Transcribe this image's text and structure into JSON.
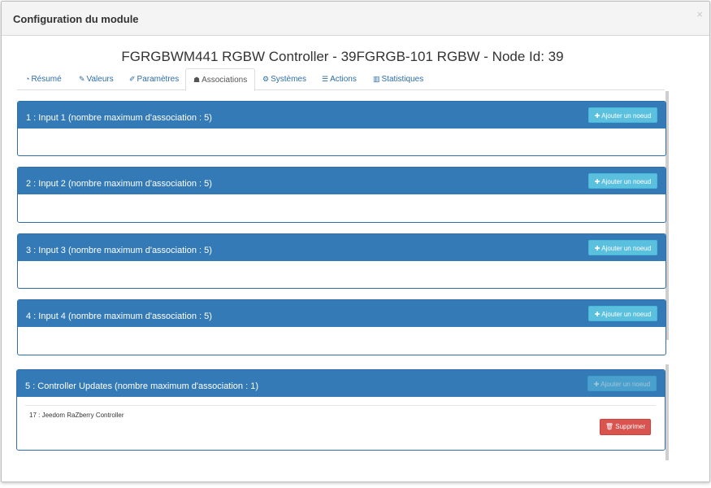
{
  "modal": {
    "title": "Configuration du module",
    "close": "×"
  },
  "node_title": "FGRGBWM441 RGBW Controller - 39FGRGB-101 RGBW - Node Id: 39",
  "tabs": [
    {
      "label": "Résumé",
      "icon": "dashboard-icon",
      "glyph": "◔"
    },
    {
      "label": "Valeurs",
      "icon": "tag-icon",
      "glyph": "✎"
    },
    {
      "label": "Paramètres",
      "icon": "wrench-icon",
      "glyph": "✐"
    },
    {
      "label": "Associations",
      "icon": "users-icon",
      "glyph": "☗"
    },
    {
      "label": "Systèmes",
      "icon": "cogs-icon",
      "glyph": "⚙"
    },
    {
      "label": "Actions",
      "icon": "sliders-icon",
      "glyph": "☰"
    },
    {
      "label": "Statistiques",
      "icon": "bar-chart-icon",
      "glyph": "▥"
    }
  ],
  "groups": [
    {
      "title": "1 : Input 1 (nombre maximum d'association : 5)",
      "button": "✚ Ajouter un noeud"
    },
    {
      "title": "2 : Input 2 (nombre maximum d'association : 5)",
      "button": "✚ Ajouter un noeud"
    },
    {
      "title": "3 : Input 3 (nombre maximum d'association : 5)",
      "button": "✚ Ajouter un noeud"
    },
    {
      "title": "4 : Input 4 (nombre maximum d'association : 5)",
      "button": "✚ Ajouter un noeud"
    },
    {
      "title": "5 : Controller Updates (nombre maximum d'association : 1)",
      "button": "✚ Ajouter un noeud",
      "associations": [
        {
          "label": "17 : Jeedom RaZberry Controller",
          "delete": "🗑 Supprimer"
        }
      ]
    }
  ],
  "colors": {
    "panel_header": "#337ab7",
    "info_button": "#5bc0de",
    "danger_button": "#d9534f"
  }
}
